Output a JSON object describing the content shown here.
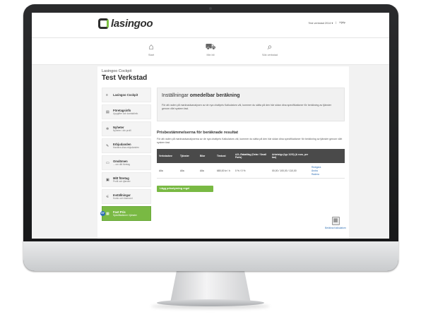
{
  "app": {
    "logo_text": "lasingoo",
    "brand_color": "#79b943"
  },
  "userbar": {
    "user": "Test verkstad 2014 ▾",
    "separator": "|",
    "link": "Hjälp"
  },
  "nav": [
    {
      "icon": "home-icon",
      "glyph": "⌂",
      "label": "Start"
    },
    {
      "icon": "car-icon",
      "glyph": "⛟",
      "label": "Min bil"
    },
    {
      "icon": "search-icon",
      "glyph": "⌕",
      "label": "Sök verkstad"
    }
  ],
  "breadcrumb": "Lasingoo Cockpit",
  "page_title": "Test Verkstad",
  "sidebar": [
    {
      "icon": "menu-icon",
      "glyph": "≡",
      "label": "Lasingoo Cockpit",
      "sub": "",
      "active": false
    },
    {
      "icon": "building-icon",
      "glyph": "▤",
      "label": "Företagsinfo",
      "sub": "Uppgifter och kontaktinfo",
      "active": false
    },
    {
      "icon": "gear-icon",
      "glyph": "✲",
      "label": "Nyheter",
      "sub": "Nyheter i din profil",
      "active": false
    },
    {
      "icon": "tag-icon",
      "glyph": "✎",
      "label": "Erbjudanden",
      "sub": "Hantera dina erbjudanden",
      "active": false
    },
    {
      "icon": "wrench-icon",
      "glyph": "▭",
      "label": "Omdömen",
      "sub": "... om ditt företag",
      "active": false
    },
    {
      "icon": "company-icon",
      "glyph": "▣",
      "label": "Mitt företag",
      "sub": "Profil och tjänster",
      "active": false
    },
    {
      "icon": "settings-icon",
      "glyph": "⚟",
      "label": "Inställningar",
      "sub": "Konto och lösenord",
      "active": false
    },
    {
      "icon": "price-icon",
      "glyph": "▦",
      "label": "Fast Pris",
      "sub": "Specifikationer i tjänster",
      "active": true,
      "badge": "NY"
    }
  ],
  "infobox": {
    "title_prefix": "Inställningar",
    "title_bold": "omedelbar beräkning",
    "text": "För att raden på marknadsanalysen av de nya chattpris Kalkulators väl, kommer du sätta på den här sidan dina specifikationer för beräkning av tjänster genom vårt system fast."
  },
  "section": {
    "title": "Prisbestämmelserna för beräknade resultat",
    "text": "För att raden på marknadsanalyserna av de nya chattpris Kalkulators väl, kommer du sätta på den här sidan dina specifikationer för beräkning av tjänster genom vårt system fast."
  },
  "table": {
    "headers": [
      "Verkstadsnr",
      "Tjänster",
      "Bilar",
      "Timkost",
      "AJL-Rabattlag (Delar / Small Parts)",
      "Arbetstyp (typ 1/2/3) (& euro, per bar)",
      ""
    ],
    "rows": [
      {
        "cells": [
          "Alla",
          "Alla",
          "Alla",
          "680,00 kr / h",
          "0 % / 0 %",
          "00,00 / 100,00 / 110,00"
        ],
        "links": [
          "Redigera",
          "Ändra",
          "Radera"
        ]
      }
    ]
  },
  "add_button": "Lägg prisstyrning regel",
  "calculator": {
    "icon": "calculator-icon",
    "glyph": "▦",
    "label": "Beräkna Kalkulatorn"
  }
}
